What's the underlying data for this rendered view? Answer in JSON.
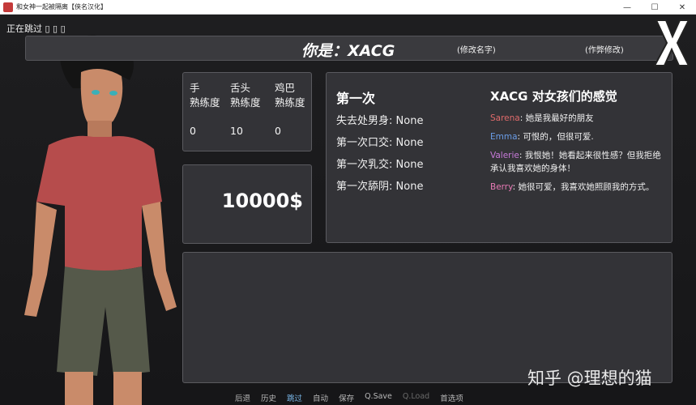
{
  "window": {
    "title": "和女神一起被隔离【侠名汉化】",
    "controls": [
      "—",
      "☐",
      "✕"
    ]
  },
  "skip_indicator": "正在跳过 ▯ ▯ ▯",
  "header": {
    "you_are": "你是：XACG",
    "rename": "(修改名字)",
    "cheat": "(作弊修改)"
  },
  "skills": [
    {
      "label_line1": "手",
      "label_line2": "熟练度",
      "value": "0"
    },
    {
      "label_line1": "舌头",
      "label_line2": "熟练度",
      "value": "10"
    },
    {
      "label_line1": "鸡巴",
      "label_line2": "熟练度",
      "value": "0"
    }
  ],
  "money": "10000$",
  "firsts": {
    "title": "第一次",
    "rows": [
      {
        "label": "失去处男身:",
        "value": "None"
      },
      {
        "label": "第一次口交:",
        "value": "None"
      },
      {
        "label": "第一次乳交:",
        "value": "None"
      },
      {
        "label": "第一次舔阴:",
        "value": "None"
      }
    ]
  },
  "feelings": {
    "title": "XACG 对女孩们的感觉",
    "rows": [
      {
        "name": "Sarena",
        "color": "#e06b6b",
        "text": ": 她是我最好的朋友"
      },
      {
        "name": "Emma",
        "color": "#6a9de8",
        "text": ": 可恨的，但很可爱."
      },
      {
        "name": "Valerie",
        "color": "#c77ad9",
        "text": ": 我恨她！她看起来很性感？但我拒绝承认我喜欢她的身体！"
      },
      {
        "name": "Berry",
        "color": "#e87ab6",
        "text": ": 她很可爱，我喜欢她照顾我的方式。"
      }
    ]
  },
  "watermark": "知乎 @理想的猫",
  "menu": [
    {
      "label": "后退",
      "state": "normal"
    },
    {
      "label": "历史",
      "state": "normal"
    },
    {
      "label": "跳过",
      "state": "active"
    },
    {
      "label": "自动",
      "state": "normal"
    },
    {
      "label": "保存",
      "state": "normal"
    },
    {
      "label": "Q.Save",
      "state": "normal"
    },
    {
      "label": "Q.Load",
      "state": "disabled"
    },
    {
      "label": "首选项",
      "state": "normal"
    }
  ]
}
